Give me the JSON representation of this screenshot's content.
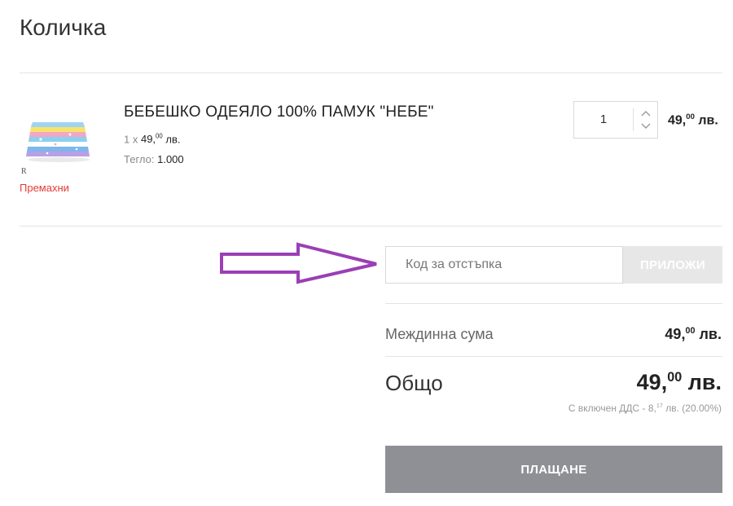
{
  "page": {
    "title": "Количка"
  },
  "cart_item": {
    "name": "БЕБЕШКО ОДЕЯЛО 100% ПАМУК \"НЕБЕ\"",
    "qty_prefix": "1 x",
    "unit_price_int": "49,",
    "unit_price_dec": "00",
    "currency": "лв.",
    "weight_label": "Тегло:",
    "weight_value": "1.000",
    "remove_label": "Премахни",
    "thumb_badge": "R",
    "quantity": "1",
    "line_price_int": "49,",
    "line_price_dec": "00",
    "line_currency": "лв."
  },
  "coupon": {
    "placeholder": "Код за отстъпка",
    "apply_label": "ПРИЛОЖИ"
  },
  "summary": {
    "subtotal_label": "Междинна сума",
    "subtotal_int": "49,",
    "subtotal_dec": "00",
    "subtotal_currency": "лв.",
    "total_label": "Общо",
    "total_int": "49,",
    "total_dec": "00",
    "total_currency": "лв.",
    "vat_prefix": "С включен ДДС -",
    "vat_int": "8,",
    "vat_dec": "17",
    "vat_suffix": "лв. (20.00%)"
  },
  "checkout": {
    "label": "ПЛАЩАНЕ"
  },
  "colors": {
    "remove": "#e53935",
    "annotation_arrow": "#9b3fb5",
    "checkout_bg": "#8f9096",
    "apply_bg": "#e7e7e7"
  }
}
